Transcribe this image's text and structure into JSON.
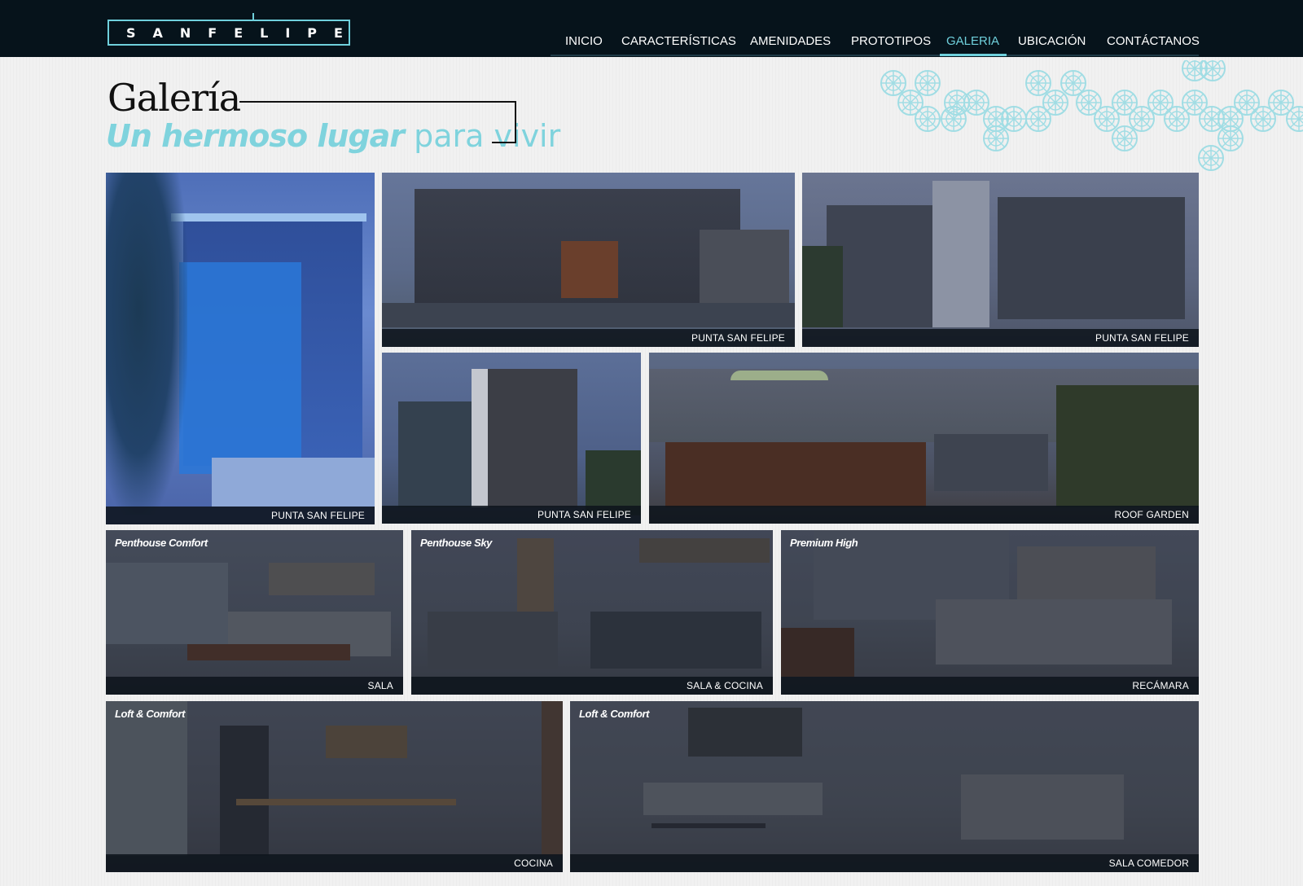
{
  "brand": {
    "logo_text": "SANFELIPE"
  },
  "nav": {
    "items": [
      {
        "label": "INICIO",
        "active": false
      },
      {
        "label": "CARACTERÍSTICAS",
        "active": false
      },
      {
        "label": "AMENIDADES",
        "active": false
      },
      {
        "label": "PROTOTIPOS",
        "active": false
      },
      {
        "label": "GALERIA",
        "active": true
      },
      {
        "label": "UBICACIÓN",
        "active": false
      },
      {
        "label": "CONTÁCTANOS",
        "active": false
      }
    ]
  },
  "page": {
    "title": "Galería",
    "subtitle_strong": "Un hermoso lugar",
    "subtitle_light": "para vivir"
  },
  "gallery": {
    "tiles": [
      {
        "caption": "PUNTA SAN FELIPE",
        "tag": ""
      },
      {
        "caption": "PUNTA SAN FELIPE",
        "tag": ""
      },
      {
        "caption": "PUNTA SAN FELIPE",
        "tag": ""
      },
      {
        "caption": "PUNTA SAN FELIPE",
        "tag": ""
      },
      {
        "caption": "ROOF GARDEN",
        "tag": ""
      },
      {
        "caption": "SALA",
        "tag": "Penthouse Comfort"
      },
      {
        "caption": "SALA &  COCINA",
        "tag": "Penthouse Sky"
      },
      {
        "caption": "RECÁMARA",
        "tag": "Premium High"
      },
      {
        "caption": "COCINA",
        "tag": "Loft & Comfort"
      },
      {
        "caption": "SALA COMEDOR",
        "tag": "Loft & Comfort"
      }
    ]
  },
  "colors": {
    "header_bg": "#06131b",
    "accent": "#6fd0dc",
    "caption_bar": "#0e141c"
  }
}
